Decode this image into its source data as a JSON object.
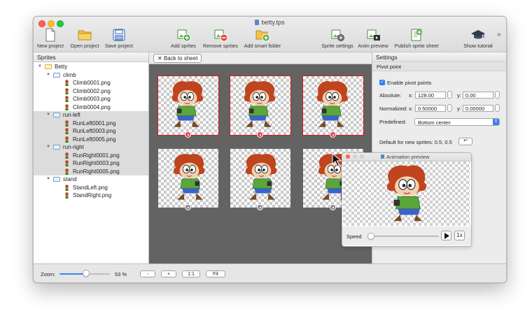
{
  "window": {
    "title": "betty.tps"
  },
  "toolbar": {
    "items": [
      {
        "label": "New project",
        "icon": "new-document-icon"
      },
      {
        "label": "Open project",
        "icon": "folder-icon"
      },
      {
        "label": "Save project",
        "icon": "floppy-disk-icon"
      },
      {
        "label": "Add sprites",
        "icon": "add-sprite-icon"
      },
      {
        "label": "Remove sprites",
        "icon": "remove-sprite-icon"
      },
      {
        "label": "Add smart folder",
        "icon": "add-folder-icon"
      },
      {
        "label": "Sprite settings",
        "icon": "sprite-settings-icon"
      },
      {
        "label": "Anim preview",
        "icon": "animation-preview-icon"
      },
      {
        "label": "Publish sprite sheet",
        "icon": "publish-icon"
      },
      {
        "label": "Show tutorial",
        "icon": "graduation-cap-icon"
      }
    ],
    "overflow": "»"
  },
  "sprites_panel": {
    "header": "Sprites",
    "tree": [
      {
        "level": 0,
        "type": "folder",
        "label": "Betty",
        "expanded": true
      },
      {
        "level": 1,
        "type": "folder",
        "label": "climb",
        "expanded": true
      },
      {
        "level": 2,
        "type": "sprite",
        "label": "Climb0001.png"
      },
      {
        "level": 2,
        "type": "sprite",
        "label": "Climb0002.png"
      },
      {
        "level": 2,
        "type": "sprite",
        "label": "Climb0003.png"
      },
      {
        "level": 2,
        "type": "sprite",
        "label": "Climb0004.png"
      },
      {
        "level": 1,
        "type": "folder",
        "label": "run-left",
        "expanded": true,
        "selected": true
      },
      {
        "level": 2,
        "type": "sprite",
        "label": "RunLeft0001.png",
        "selected": true
      },
      {
        "level": 2,
        "type": "sprite",
        "label": "RunLeft0003.png",
        "selected": true
      },
      {
        "level": 2,
        "type": "sprite",
        "label": "RunLeft0005.png",
        "selected": true
      },
      {
        "level": 1,
        "type": "folder",
        "label": "run-right",
        "expanded": true,
        "selected": true
      },
      {
        "level": 2,
        "type": "sprite",
        "label": "RunRight0001.png",
        "selected": true
      },
      {
        "level": 2,
        "type": "sprite",
        "label": "RunRight0003.png",
        "selected": true
      },
      {
        "level": 2,
        "type": "sprite",
        "label": "RunRight0005.png",
        "selected": true
      },
      {
        "level": 1,
        "type": "folder",
        "label": "stand",
        "expanded": true
      },
      {
        "level": 2,
        "type": "sprite",
        "label": "StandLeft.png"
      },
      {
        "level": 2,
        "type": "sprite",
        "label": "StandRight.png"
      }
    ]
  },
  "canvas": {
    "back_button": "Back to sheet",
    "frames": [
      {
        "highlighted": true,
        "facing": "left"
      },
      {
        "highlighted": true,
        "facing": "left"
      },
      {
        "highlighted": true,
        "facing": "left"
      },
      {
        "highlighted": false,
        "facing": "right"
      },
      {
        "highlighted": false,
        "facing": "right"
      },
      {
        "highlighted": false,
        "facing": "right"
      }
    ]
  },
  "settings": {
    "header": "Settings",
    "section": "Pivot point",
    "enable_label": "Enable pivot points",
    "enabled": true,
    "absolute_label": "Absolute:",
    "absolute_x_label": "x:",
    "absolute_x": "128.00",
    "absolute_y_label": "y:",
    "absolute_y": "0.00",
    "normalized_label": "Normalized:",
    "normalized_x_label": "x:",
    "normalized_x": "0.50000",
    "normalized_y_label": "y:",
    "normalized_y": "0.00000",
    "predefined_label": "Predefined:",
    "predefined_value": "Bottom center",
    "default_text": "Default for new sprites: 0.5, 0.5"
  },
  "animation_preview": {
    "title": "Animation preview",
    "speed_label": "Speed",
    "speed_level": 0.0,
    "play_icon": "play-icon",
    "rate": "1x"
  },
  "statusbar": {
    "zoom_label": "Zoom:",
    "zoom_level": 0.53,
    "zoom_text": "53 %",
    "buttons": [
      "-",
      "+",
      "1:1",
      "Fit"
    ]
  }
}
